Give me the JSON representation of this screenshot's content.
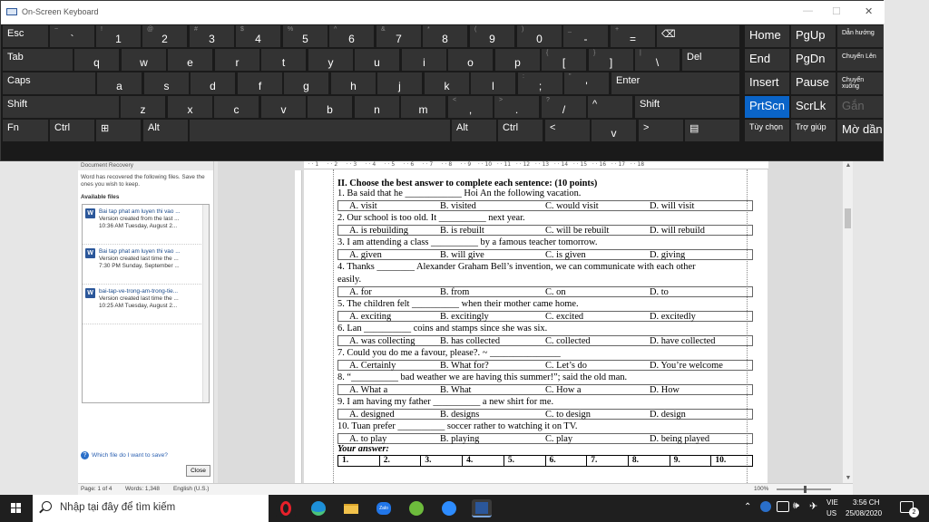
{
  "keyboard": {
    "title": "On-Screen Keyboard",
    "rows": [
      [
        {
          "k": "Esc"
        },
        {
          "s": "~",
          "k": "`"
        },
        {
          "s": "!",
          "k": "1"
        },
        {
          "s": "@",
          "k": "2"
        },
        {
          "s": "#",
          "k": "3"
        },
        {
          "s": "$",
          "k": "4"
        },
        {
          "s": "%",
          "k": "5"
        },
        {
          "s": "^",
          "k": "6"
        },
        {
          "s": "&",
          "k": "7"
        },
        {
          "s": "*",
          "k": "8"
        },
        {
          "s": "(",
          "k": "9"
        },
        {
          "s": ")",
          "k": "0"
        },
        {
          "s": "_",
          "k": "-"
        },
        {
          "s": "+",
          "k": "="
        },
        {
          "k": "⌫"
        }
      ],
      [
        {
          "k": "Tab"
        },
        {
          "k": "q"
        },
        {
          "k": "w"
        },
        {
          "k": "e"
        },
        {
          "k": "r"
        },
        {
          "k": "t"
        },
        {
          "k": "y"
        },
        {
          "k": "u"
        },
        {
          "k": "i"
        },
        {
          "k": "o"
        },
        {
          "k": "p"
        },
        {
          "s": "{",
          "k": "["
        },
        {
          "s": "}",
          "k": "]"
        },
        {
          "s": "|",
          "k": "\\"
        },
        {
          "k": "Del"
        }
      ],
      [
        {
          "k": "Caps"
        },
        {
          "k": "a"
        },
        {
          "k": "s"
        },
        {
          "k": "d"
        },
        {
          "k": "f"
        },
        {
          "k": "g"
        },
        {
          "k": "h"
        },
        {
          "k": "j"
        },
        {
          "k": "k"
        },
        {
          "k": "l"
        },
        {
          "s": ":",
          "k": ";"
        },
        {
          "s": "\"",
          "k": "'"
        },
        {
          "k": "Enter"
        }
      ],
      [
        {
          "k": "Shift"
        },
        {
          "k": "z"
        },
        {
          "k": "x"
        },
        {
          "k": "c"
        },
        {
          "k": "v"
        },
        {
          "k": "b"
        },
        {
          "k": "n"
        },
        {
          "k": "m"
        },
        {
          "s": "<",
          "k": ","
        },
        {
          "s": ">",
          "k": "."
        },
        {
          "s": "?",
          "k": "/"
        },
        {
          "k": "^"
        },
        {
          "k": "Shift"
        }
      ],
      [
        {
          "k": "Fn"
        },
        {
          "k": "Ctrl"
        },
        {
          "k": "⊞"
        },
        {
          "k": "Alt"
        },
        {
          "k": ""
        },
        {
          "k": "Alt"
        },
        {
          "k": "Ctrl"
        },
        {
          "k": "<"
        },
        {
          "k": "v"
        },
        {
          "k": ">"
        },
        {
          "k": "▤"
        }
      ]
    ],
    "nav": [
      [
        "Home",
        "PgUp",
        "Dẫn hướng"
      ],
      [
        "End",
        "PgDn",
        "Chuyển Lên"
      ],
      [
        "Insert",
        "Pause",
        "Chuyển xuống"
      ],
      [
        "PrtScn",
        "ScrLk",
        "Gắn"
      ],
      [
        "Tùy chọn",
        "Trợ giúp",
        "Mờ dần"
      ]
    ]
  },
  "recovery": {
    "header": "Document Recovery",
    "message": "Word has recovered the following files. Save the ones you wish to keep.",
    "available": "Available files",
    "files": [
      {
        "name": "Bai tap phat am luyen thi vao ...",
        "version": "Version created from the last ...",
        "time": "10:36 AM Tuesday, August 2..."
      },
      {
        "name": "Bai tap phat am luyen thi vao ...",
        "version": "Version created last time the ...",
        "time": "7:30 PM Sunday, September ..."
      },
      {
        "name": "bai-tap-ve-trong-am-trong-tie...",
        "version": "Version created last time the ...",
        "time": "10:25 AM Tuesday, August 2..."
      }
    ],
    "help": "Which file do I want to save?",
    "close": "Close"
  },
  "status": {
    "page": "Page: 1 of 4",
    "words": "Words: 1,348",
    "lang": "English (U.S.)",
    "zoom": "100%"
  },
  "doc": {
    "heading": "II. Choose the best answer to complete each sentence: (10 points)",
    "questions": [
      {
        "q": "1. Ba said that he ____________ Hoi An the following vacation.",
        "opts": [
          "A. visit",
          "B. visited",
          "C. would visit",
          "D. will visit"
        ]
      },
      {
        "q": "2. Our school is too old. It __________ next year.",
        "opts": [
          "A. is rebuilding",
          "B. is rebuilt",
          "C. will be rebuilt",
          "D. will rebuild"
        ]
      },
      {
        "q": "3. I am attending a class __________ by a famous teacher tomorrow.",
        "opts": [
          "A. given",
          "B. will give",
          "C. is given",
          "D. giving"
        ]
      },
      {
        "q": "4. Thanks ________ Alexander Graham Bell’s invention, we can communicate with each other",
        "q2": "easily.",
        "opts": [
          "A. for",
          "B. from",
          "C. on",
          "D. to"
        ]
      },
      {
        "q": "5. The children felt __________ when their mother came home.",
        "opts": [
          "A. exciting",
          "B. excitingly",
          "C. excited",
          "D. excitedly"
        ]
      },
      {
        "q": "6. Lan __________ coins and stamps since she was six.",
        "opts": [
          "A. was collecting",
          "B. has collected",
          "C. collected",
          "D. have collected"
        ]
      },
      {
        "q": "7.  Could you do me a favour, please?. ~ _______________",
        "opts": [
          "A. Certainly",
          "B. What for?",
          "C. Let’s do",
          "D. You’re welcome"
        ]
      },
      {
        "q": "8. “__________ bad weather we are having this summer!”; said the old man.",
        "opts": [
          "A. What a",
          "B. What",
          "C. How a",
          "D. How"
        ]
      },
      {
        "q": "9. I am having my father __________ a new shirt for me.",
        "opts": [
          "A. designed",
          "B. designs",
          "C. to design",
          "D. design"
        ]
      },
      {
        "q": "10. Tuan prefer __________ soccer rather to watching it on TV.",
        "opts": [
          "A. to play",
          "B. playing",
          "C. play",
          "D. being played"
        ]
      }
    ],
    "your_answer": "Your answer:",
    "answer_cells": [
      "1.",
      "2.",
      "3.",
      "4.",
      "5.",
      "6.",
      "7.",
      "8.",
      "9.",
      "10."
    ]
  },
  "taskbar": {
    "search_placeholder": "Nhập tại đây để tìm kiếm",
    "lang1": "VIE",
    "lang2": "US",
    "time": "3:56 CH",
    "date": "25/08/2020",
    "notif": "2"
  },
  "ruler": [
    "1",
    "2",
    "3",
    "4",
    "5",
    "6",
    "7",
    "8",
    "9",
    "10",
    "11",
    "12",
    "13",
    "14",
    "15",
    "16",
    "17",
    "18"
  ]
}
